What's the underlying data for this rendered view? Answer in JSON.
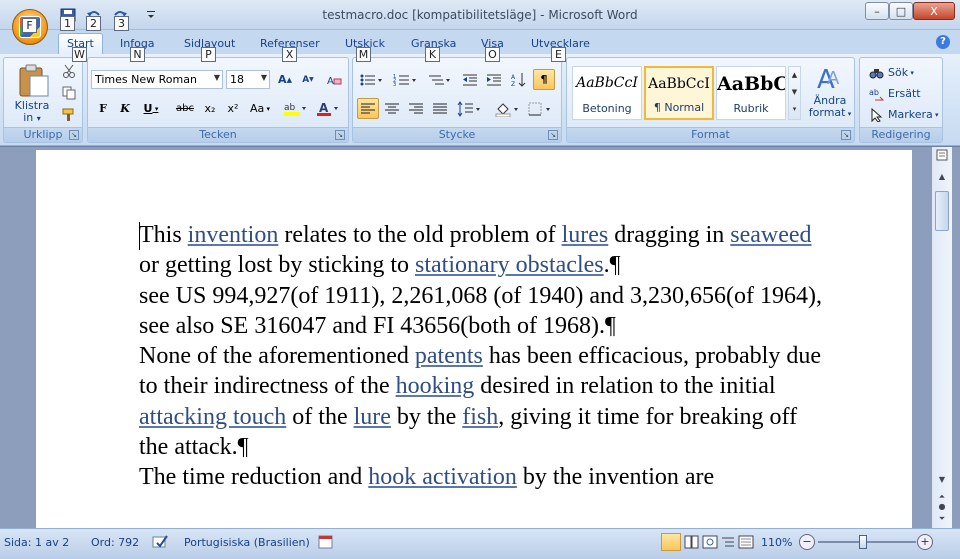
{
  "titlebar": {
    "title": "testmacro.doc [kompatibilitetsläge] - Microsoft Word",
    "keytips": [
      "1",
      "2",
      "3"
    ],
    "controls": {
      "minimize": "–",
      "maximize": "□",
      "close": "X"
    }
  },
  "ribbon_tabs": [
    {
      "label": "Start",
      "keytip": "W"
    },
    {
      "label": "Infoga",
      "keytip": "N"
    },
    {
      "label": "Sidlayout",
      "keytip": "P"
    },
    {
      "label": "Referenser",
      "keytip": "X"
    },
    {
      "label": "Utskick",
      "keytip": "M"
    },
    {
      "label": "Granska",
      "keytip": "K"
    },
    {
      "label": "Visa",
      "keytip": "O"
    },
    {
      "label": "Utvecklare",
      "keytip": "E"
    }
  ],
  "active_tab": "Start",
  "groups": {
    "clipboard": {
      "label": "Urklipp",
      "paste_label_1": "Klistra",
      "paste_label_2": "in"
    },
    "font": {
      "label": "Tecken",
      "font_name": "Times New Roman",
      "font_size": "18",
      "buttons": {
        "bold": "F",
        "italic": "K",
        "underline": "U",
        "strike": "abc",
        "subscript": "x₂",
        "superscript": "x²",
        "change_case": "Aa"
      }
    },
    "paragraph": {
      "label": "Stycke"
    },
    "styles": {
      "label": "Format",
      "items": [
        {
          "sample": "AaBbCcI",
          "name": "Betoning"
        },
        {
          "sample": "AaBbCcI",
          "name": "¶ Normal"
        },
        {
          "sample": "AaBbC",
          "name": "Rubrik"
        }
      ],
      "change_styles_1": "Ändra",
      "change_styles_2": "format"
    },
    "editing": {
      "label": "Redigering",
      "find": "Sök",
      "replace": "Ersätt",
      "select": "Markera"
    }
  },
  "document": {
    "paragraphs": [
      [
        {
          "text": "This "
        },
        {
          "text": "invention",
          "link": true
        },
        {
          "text": " relates to the old problem of "
        },
        {
          "text": "lures",
          "link": true
        },
        {
          "text": " dragging in "
        },
        {
          "text": "seaweed ",
          "link": true
        },
        {
          "text": " or getting lost by sticking to "
        },
        {
          "text": "stationary obstacles",
          "link": true
        },
        {
          "text": ".¶"
        }
      ],
      [
        {
          "text": "see US 994,927(of 1911), 2,261,068 (of 1940) and 3,230,656(of 1964), see also SE 316047 and FI 43656(both of 1968).¶"
        }
      ],
      [
        {
          "text": "None of the aforementioned "
        },
        {
          "text": "patents",
          "link": true
        },
        {
          "text": " has been efficacious, probably due to their indirectness of the "
        },
        {
          "text": "hooking",
          "link": true
        },
        {
          "text": " desired in relation to the initial "
        },
        {
          "text": "attacking touch",
          "link": true
        },
        {
          "text": " of the "
        },
        {
          "text": "lure",
          "link": true
        },
        {
          "text": " by the "
        },
        {
          "text": "fish",
          "link": true
        },
        {
          "text": ", giving it time for breaking off the attack.¶"
        }
      ],
      [
        {
          "text": "The time reduction and "
        },
        {
          "text": "hook activation",
          "link": true
        },
        {
          "text": " by the invention are "
        }
      ]
    ]
  },
  "statusbar": {
    "page": "Sida: 1 av 2",
    "words": "Ord: 792",
    "language": "Portugisiska (Brasilien)",
    "zoom": "110%"
  }
}
